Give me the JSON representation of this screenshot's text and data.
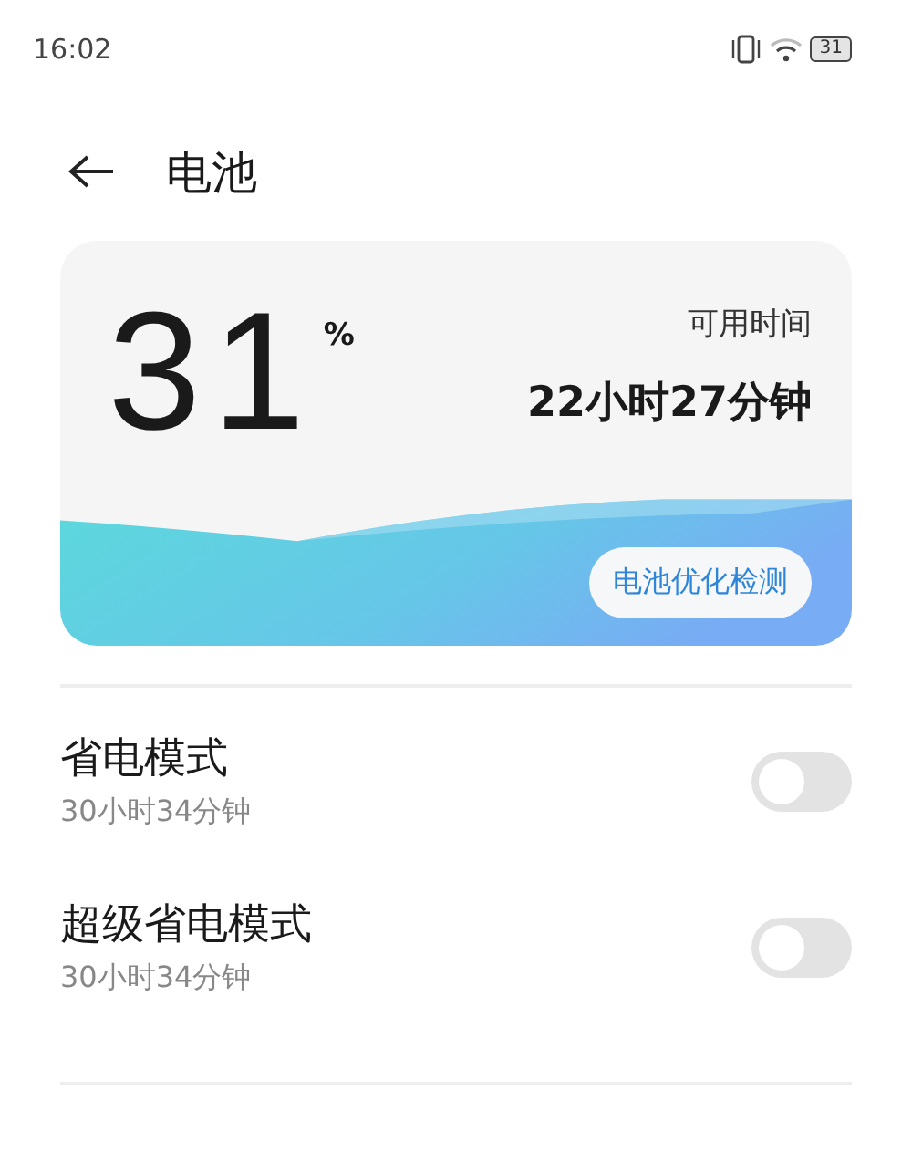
{
  "status_bar": {
    "time": "16:02",
    "battery_text": "31"
  },
  "header": {
    "title": "电池"
  },
  "battery_card": {
    "percent": "31",
    "percent_sign": "%",
    "available_label": "可用时间",
    "available_time": "22小时27分钟",
    "action": "电池优化检测"
  },
  "settings": [
    {
      "title": "省电模式",
      "subtitle": "30小时34分钟",
      "on": false
    },
    {
      "title": "超级省电模式",
      "subtitle": "30小时34分钟",
      "on": false
    }
  ]
}
